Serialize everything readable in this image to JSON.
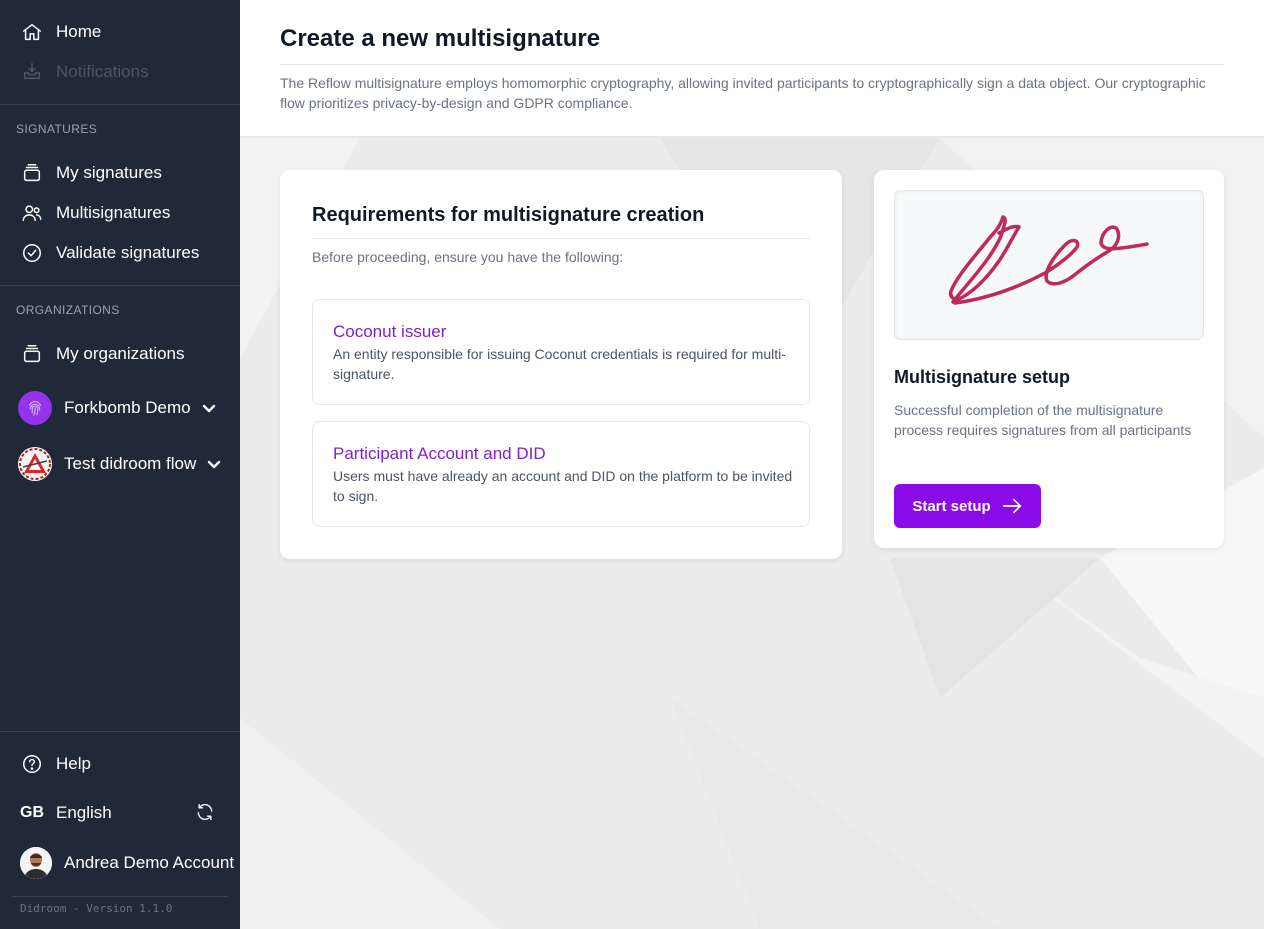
{
  "sidebar": {
    "home": "Home",
    "notifications": "Notifications",
    "signatures_section": "SIGNATURES",
    "my_signatures": "My signatures",
    "multisignatures": "Multisignatures",
    "validate_signatures": "Validate signatures",
    "organizations_section": "ORGANIZATIONS",
    "my_organizations": "My organizations",
    "orgs": [
      {
        "name": "Forkbomb Demo"
      },
      {
        "name": "Test didroom flow"
      }
    ],
    "help": "Help",
    "language_code": "GB",
    "language": "English",
    "user": "Andrea Demo Account",
    "version": "Didroom - Version 1.1.0"
  },
  "header": {
    "title": "Create a new multisignature",
    "description": "The Reflow multisignature employs homomorphic cryptography, allowing invited participants to cryptographically sign a data object. Our cryptographic flow prioritizes privacy-by-design and GDPR compliance."
  },
  "requirements": {
    "title": "Requirements for multisignature creation",
    "subtitle": "Before proceeding, ensure you have the following:",
    "items": [
      {
        "title": "Coconut issuer",
        "description": "An entity responsible for issuing Coconut credentials is required for multi-signature."
      },
      {
        "title": "Participant Account and DID",
        "description": "Users must have already an account and DID on the platform to be invited to sign."
      }
    ]
  },
  "setup": {
    "title": "Multisignature setup",
    "description": "Successful completion of the multisignature process requires signatures from all participants",
    "button": "Start setup"
  },
  "colors": {
    "sidebar_bg": "#1f2937",
    "accent": "#8b0be8",
    "link": "#7e22ce",
    "signature": "#be2a5a"
  }
}
